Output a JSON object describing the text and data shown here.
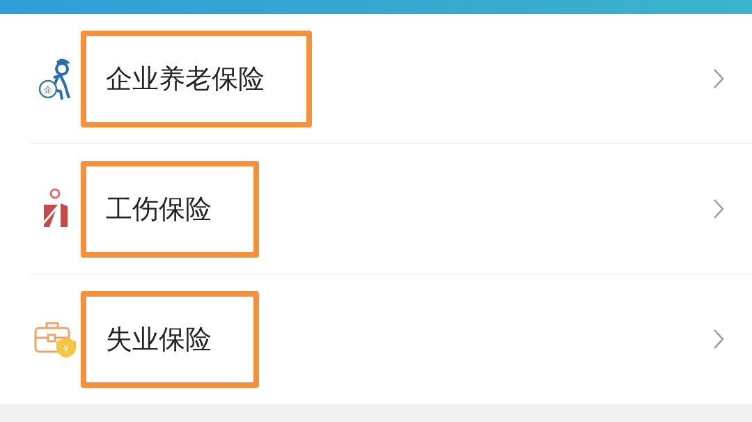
{
  "items": [
    {
      "kind": "pension",
      "label": "企业养老保险",
      "badge": "企",
      "highlighted": true
    },
    {
      "kind": "injury",
      "label": "工伤保险",
      "highlighted": true
    },
    {
      "kind": "unemployment",
      "label": "失业保险",
      "badge": "¥",
      "highlighted": true
    }
  ]
}
